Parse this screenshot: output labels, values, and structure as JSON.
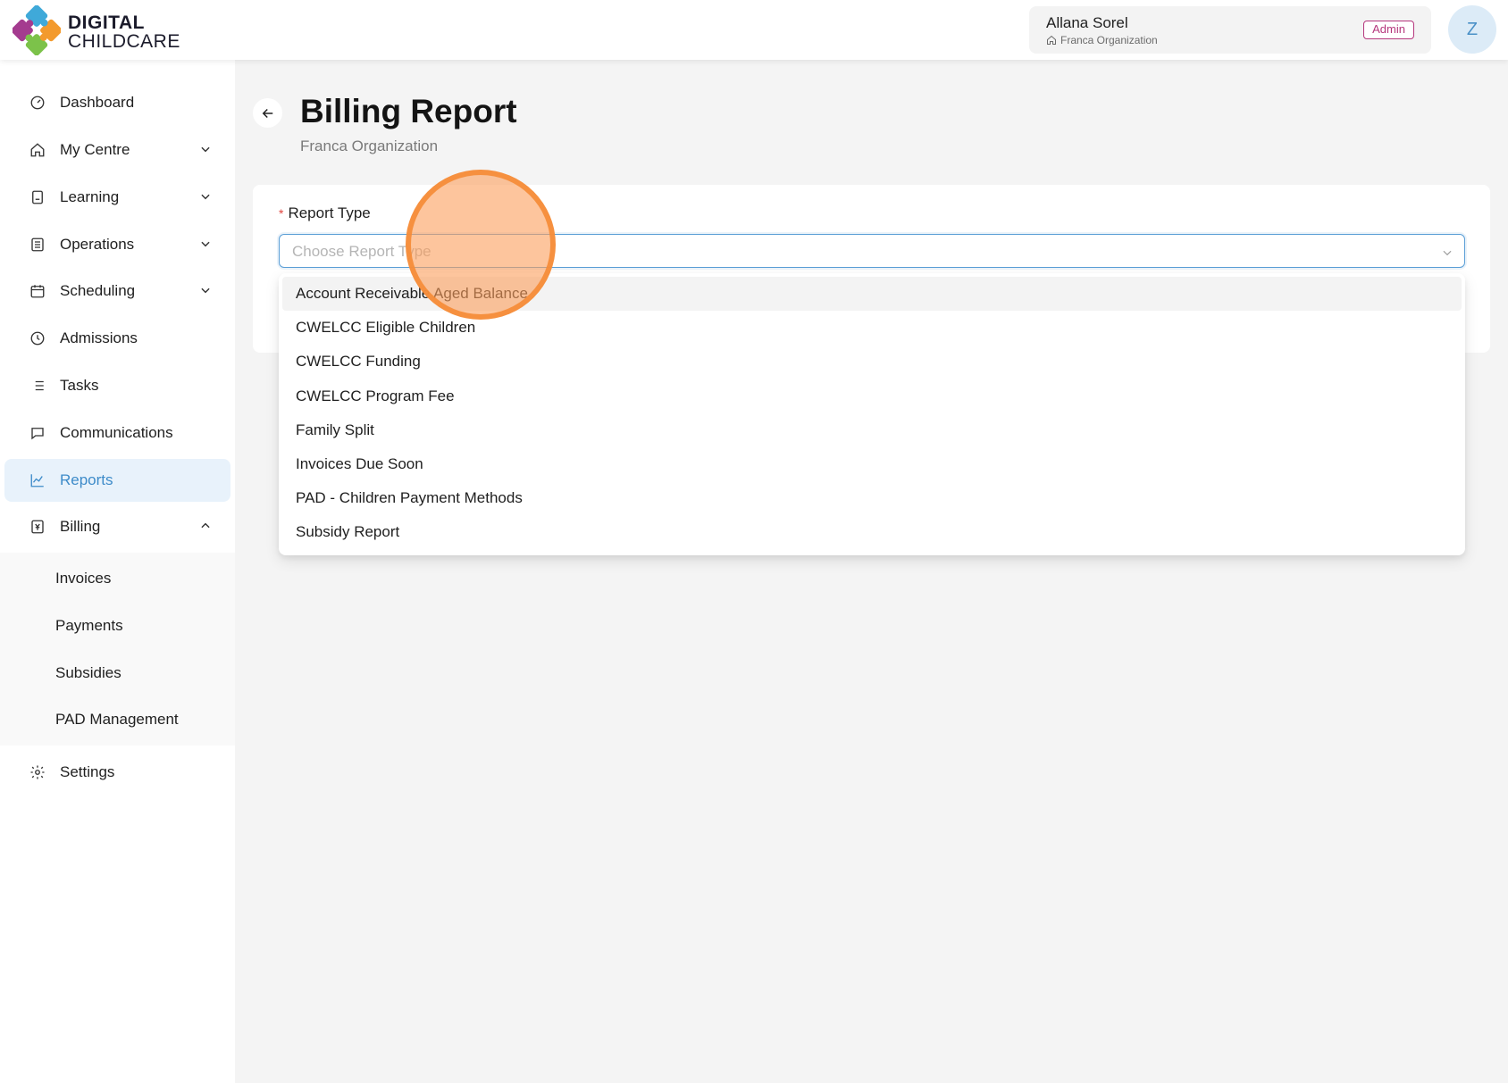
{
  "header": {
    "logo": {
      "line1": "DIGITAL",
      "line2": "CHILDCARE"
    },
    "user": {
      "name": "Allana Sorel",
      "org": "Franca Organization",
      "role": "Admin",
      "avatar_initial": "Z"
    }
  },
  "sidebar": {
    "items": [
      {
        "label": "Dashboard",
        "icon": "dashboard-icon",
        "expandable": false
      },
      {
        "label": "My Centre",
        "icon": "home-icon",
        "expandable": true
      },
      {
        "label": "Learning",
        "icon": "book-icon",
        "expandable": true
      },
      {
        "label": "Operations",
        "icon": "list-icon",
        "expandable": true
      },
      {
        "label": "Scheduling",
        "icon": "calendar-icon",
        "expandable": true
      },
      {
        "label": "Admissions",
        "icon": "clock-icon",
        "expandable": false
      },
      {
        "label": "Tasks",
        "icon": "tasks-icon",
        "expandable": false
      },
      {
        "label": "Communications",
        "icon": "chat-icon",
        "expandable": false
      },
      {
        "label": "Reports",
        "icon": "chart-icon",
        "expandable": false,
        "active": true
      },
      {
        "label": "Billing",
        "icon": "billing-icon",
        "expandable": true,
        "expanded": true
      },
      {
        "label": "Settings",
        "icon": "gear-icon",
        "expandable": false
      }
    ],
    "billing_sub": [
      "Invoices",
      "Payments",
      "Subsidies",
      "PAD Management"
    ],
    "active_color": "#3d8bc9"
  },
  "page": {
    "title": "Billing Report",
    "subtitle": "Franca Organization"
  },
  "form": {
    "report_type_label": "Report Type",
    "report_type_placeholder": "Choose Report Type",
    "options": [
      "Account Receivable Aged Balance",
      "CWELCC Eligible Children",
      "CWELCC Funding",
      "CWELCC Program Fee",
      "Family Split",
      "Invoices Due Soon",
      "PAD - Children Payment Methods",
      "Subsidy Report"
    ]
  },
  "colors": {
    "required_mark": "#e0443e",
    "admin_badge": "#b5367c",
    "click_indicator": "#f58c37"
  }
}
